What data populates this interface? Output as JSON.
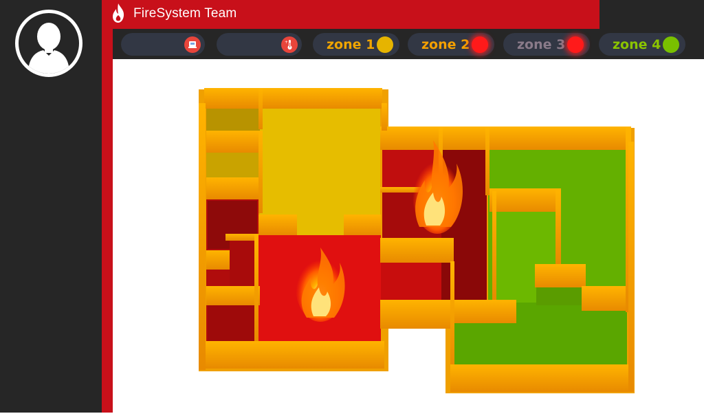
{
  "app": {
    "title": "FireSystem Team"
  },
  "sensors": [
    {
      "icon": "smoke-detector-icon",
      "value": ""
    },
    {
      "icon": "thermometer-icon",
      "value": ""
    }
  ],
  "zones": [
    {
      "label": "zone 1",
      "label_color": "#f0a500",
      "status_color": "#e6b400",
      "status": "warning"
    },
    {
      "label": "zone 2",
      "label_color": "#f5a000",
      "status_color": "#ff1a1a",
      "status": "fire"
    },
    {
      "label": "zone 3",
      "label_color": "#8a7b8a",
      "status_color": "#ff1a1a",
      "status": "fire"
    },
    {
      "label": "zone 4",
      "label_color": "#8bc400",
      "status_color": "#79c000",
      "status": "safe"
    }
  ],
  "colors": {
    "brand_red": "#c8101a",
    "panel_dark": "#262626",
    "pill_bg": "#323744"
  }
}
